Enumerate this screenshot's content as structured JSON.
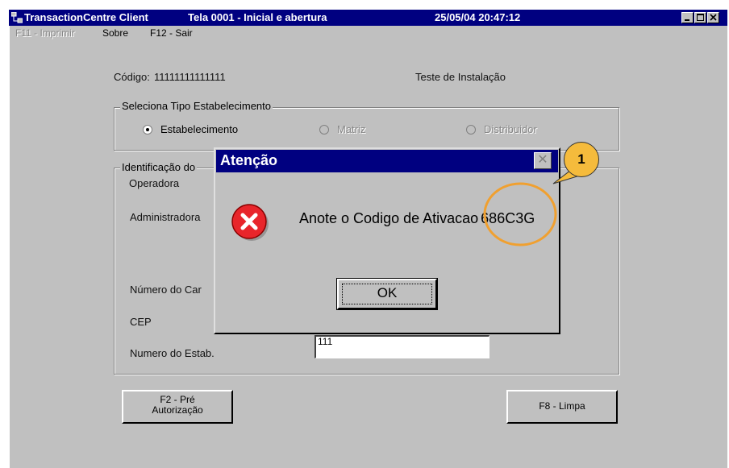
{
  "window": {
    "app_title": "TransactionCentre Client",
    "screen_title": "Tela 0001 - Inicial e abertura",
    "datetime": "25/05/04 20:47:12",
    "controls": {
      "minimize_icon": "minimize-icon",
      "maximize_icon": "maximize-icon",
      "close_icon": "close-icon"
    }
  },
  "menu": {
    "print": "F11 - Imprimir",
    "about": "Sobre",
    "exit": "F12 - Sair"
  },
  "form": {
    "codigo_label": "Código:",
    "codigo_value": "11111111111111",
    "install_test": "Teste de Instalação",
    "tipo_group": {
      "legend": "Seleciona Tipo Estabelecimento",
      "options": [
        {
          "label": "Estabelecimento",
          "checked": true,
          "enabled": true
        },
        {
          "label": "Matriz",
          "checked": false,
          "enabled": false
        },
        {
          "label": "Distribuidor",
          "checked": false,
          "enabled": false
        }
      ]
    },
    "ident_group": {
      "legend": "Identificação do",
      "fields": {
        "operadora": "Operadora",
        "administradora": "Administradora",
        "numero_cartao": "Número do Car",
        "cep": "CEP",
        "numero_estab": "Numero do Estab.",
        "numero_estab_value": "111"
      }
    },
    "buttons": {
      "pre_auth_line1": "F2 - Pré",
      "pre_auth_line2": "Autorização",
      "clear": "F8 - Limpa"
    }
  },
  "dialog": {
    "title": "Atenção",
    "message_prefix": "Anote o Codigo de Ativacao",
    "activation_code": "686C3G",
    "ok_label": "OK",
    "icon": "error-icon",
    "close_glyph": "✕"
  },
  "annotation": {
    "callout_number": "1",
    "color": "#f0a030"
  },
  "colors": {
    "titlebar": "#000080",
    "window_bg": "#c0c0c0",
    "error_red": "#e8252b"
  }
}
